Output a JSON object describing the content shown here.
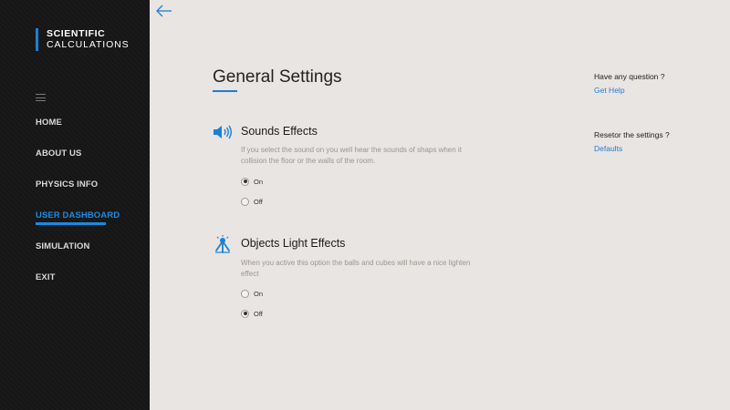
{
  "colors": {
    "accent": "#1b7fd6",
    "sidebar_bg": "#161616",
    "main_bg": "#e9e5e3"
  },
  "logo": {
    "line1": "SCIENTIFIC",
    "line2": "CALCULATIONS"
  },
  "nav": {
    "items": [
      {
        "label": "HOME",
        "active": false
      },
      {
        "label": "ABOUT US",
        "active": false
      },
      {
        "label": "PHYSICS INFO",
        "active": false
      },
      {
        "label": "USER DASHBOARD",
        "active": true
      },
      {
        "label": "SIMULATION",
        "active": false
      },
      {
        "label": "EXIT",
        "active": false
      }
    ]
  },
  "header": {
    "title": "General Settings"
  },
  "sections": [
    {
      "icon": "speaker-icon",
      "title": "Sounds Effects",
      "description": "If you select the sound on you well hear the sounds of shaps when it collision the floor or the walls of the room.",
      "options": [
        {
          "label": "On",
          "checked": true
        },
        {
          "label": "Off",
          "checked": false
        }
      ]
    },
    {
      "icon": "light-effects-icon",
      "title": "Objects Light Effects",
      "description": "When you active this option the balls and cubes will have a nice lighten effect",
      "options": [
        {
          "label": "On",
          "checked": false
        },
        {
          "label": "Off",
          "checked": true
        }
      ]
    }
  ],
  "help": {
    "question": "Have any question ?",
    "link": "Get Help",
    "reset_question": "Resetor the settings ?",
    "reset_link": "Defaults"
  }
}
